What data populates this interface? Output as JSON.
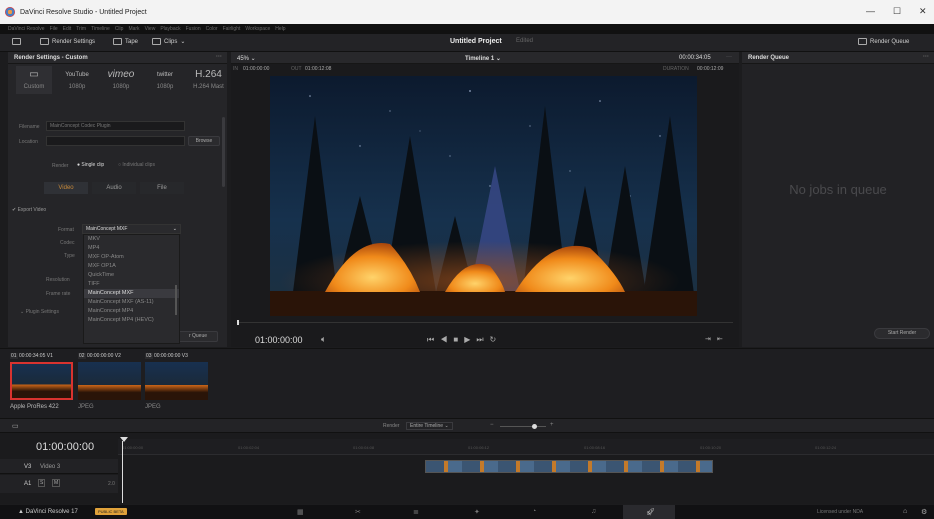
{
  "window": {
    "title": "DaVinci Resolve Studio - Untitled Project"
  },
  "menu": [
    "DaVinci Resolve",
    "File",
    "Edit",
    "Trim",
    "Timeline",
    "Clip",
    "Mark",
    "View",
    "Playback",
    "Fusion",
    "Color",
    "Fairlight",
    "Workspace",
    "Help"
  ],
  "toolbar": {
    "render_settings": "Render Settings",
    "tape": "Tape",
    "clips": "Clips",
    "project_title": "Untitled Project",
    "project_status": "Edited",
    "render_queue": "Render Queue"
  },
  "render_settings": {
    "header": "Render Settings - Custom",
    "presets": [
      {
        "icon": "▭",
        "label": "Custom"
      },
      {
        "icon": "YouTube",
        "label": "1080p"
      },
      {
        "icon": "vimeo",
        "label": "1080p"
      },
      {
        "icon": "twitter",
        "label": "1080p"
      },
      {
        "icon": "H.264",
        "label": "H.264 Mast"
      }
    ],
    "filename_label": "Filename",
    "filename_value": "MainConcept Codec Plugin",
    "location_label": "Location",
    "browse": "Browse",
    "render_label": "Render",
    "single_clip": "Single clip",
    "individual_clips": "Individual clips",
    "tabs": [
      "Video",
      "Audio",
      "File"
    ],
    "export_video": "Export Video",
    "format_label": "Format",
    "format_value": "MainConcept MXF",
    "codec_label": "Codec",
    "type_label": "Type",
    "resolution_label": "Resolution",
    "frame_rate_label": "Frame rate",
    "plugin_settings": "Plugin Settings",
    "add_queue": "r Queue",
    "format_options": [
      "MKV",
      "MP4",
      "MXF OP-Atom",
      "MXF OP1A",
      "QuickTime",
      "TIFF",
      "MainConcept MXF",
      "MainConcept MXF (AS-11)",
      "MainConcept MP4",
      "MainConcept MP4 (HEVC)"
    ],
    "selected_option": 6
  },
  "viewer": {
    "zoom": "45%",
    "timeline_name": "Timeline 1",
    "timecode_top": "00:00:34:05",
    "in_label": "IN",
    "in_tc": "01:00:00:00",
    "out_label": "OUT",
    "out_tc": "01:00:12:08",
    "duration_label": "DURATION",
    "duration_tc": "00:00:12:09",
    "current_tc": "01:00:00:00"
  },
  "render_queue": {
    "header": "Render Queue",
    "empty": "No jobs in queue",
    "start": "Start Render"
  },
  "clips": [
    {
      "num": "01",
      "tc": "00:00:34:05",
      "track": "V1",
      "label": "Apple ProRes 422"
    },
    {
      "num": "02",
      "tc": "00:00:00:00",
      "track": "V2",
      "label": "JPEG"
    },
    {
      "num": "03",
      "tc": "00:00:00:00",
      "track": "V3",
      "label": "JPEG"
    }
  ],
  "timeline": {
    "render_label": "Render",
    "range": "Entire Timeline",
    "timecode": "01:00:00:00",
    "ruler": [
      "01:00:00:00",
      "01:00:02:04",
      "01:00:04:08",
      "01:00:06:12",
      "01:00:08:16",
      "01:00:10:20",
      "01:00:12:24"
    ],
    "v3": "V3",
    "v3_name": "Video 3",
    "a1": "A1",
    "a1_level": "2.0",
    "s": "S",
    "m": "M"
  },
  "bottom": {
    "app": "DaVinci Resolve 17",
    "badge": "PUBLIC BETA",
    "license": "Licensed under NDA"
  },
  "colors": {
    "accent": "#c7893a",
    "badge": "#e0a23a",
    "clip_sel": "#d9332f"
  }
}
